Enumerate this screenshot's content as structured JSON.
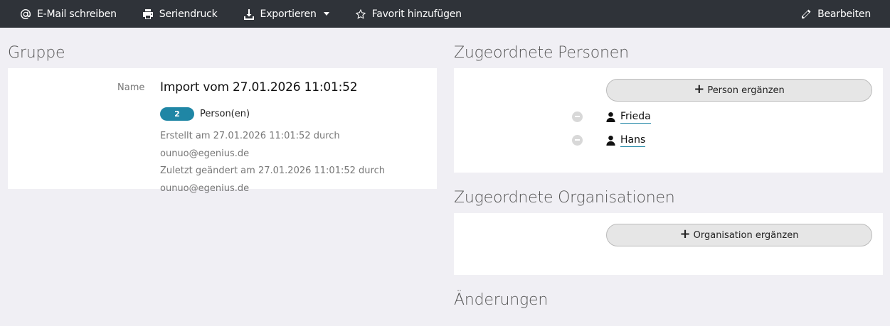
{
  "toolbar": {
    "email": "E-Mail schreiben",
    "print": "Seriendruck",
    "export": "Exportieren",
    "favorite": "Favorit hinzufügen",
    "edit": "Bearbeiten"
  },
  "group": {
    "section_title": "Gruppe",
    "name_label": "Name",
    "name": "Import vom 27.01.2026 11:01:52",
    "count": "2",
    "count_label": "Person(en)",
    "created": "Erstellt am 27.01.2026 11:01:52 durch ounuo@egenius.de",
    "modified": "Zuletzt geändert am 27.01.2026 11:01:52 durch ounuo@egenius.de"
  },
  "persons": {
    "section_title": "Zugeordnete Personen",
    "add_label": "Person ergänzen",
    "items": [
      {
        "name": "Frieda"
      },
      {
        "name": "Hans"
      }
    ]
  },
  "orgs": {
    "section_title": "Zugeordnete Organisationen",
    "add_label": "Organisation ergänzen"
  },
  "changes": {
    "section_title": "Änderungen"
  }
}
